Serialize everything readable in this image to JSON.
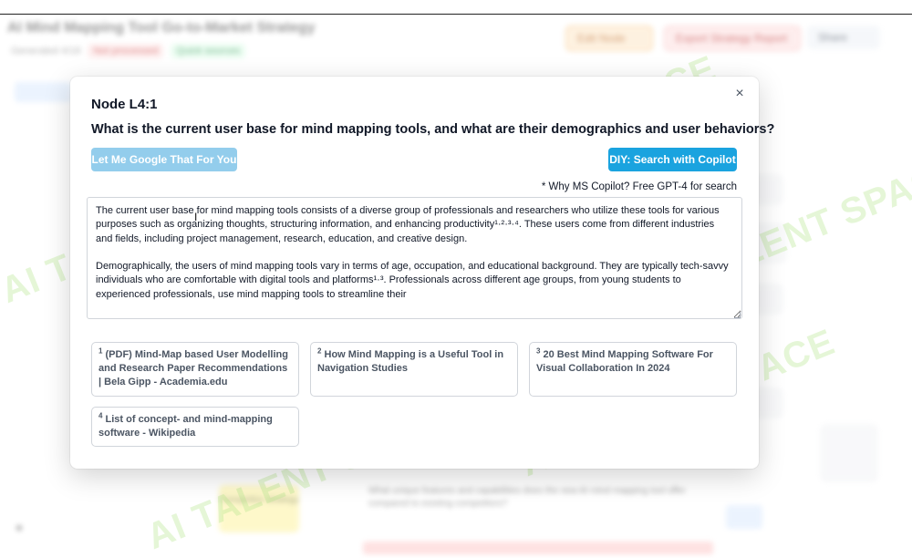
{
  "background": {
    "title": "AI Mind Mapping Tool Go-to-Market Strategy",
    "meta_text": "Generated 4/18",
    "meta_red": "Not processed",
    "meta_green": "Quick sources",
    "btn_orange": "Edit Node",
    "btn_pink": "Export Strategy Report",
    "btn_gray": "Share",
    "node_text": "Competitor strategy",
    "question_text": "What unique features and capabilities does the new AI mind mapping tool offer compared to existing competitors?"
  },
  "watermark": "AI TALENT SPACE",
  "modal": {
    "close_symbol": "×",
    "node_title": "Node L4:1",
    "question": "What is the current user base for mind mapping tools, and what are their demographics and user behaviors?",
    "google_button": "Let Me Google That For You",
    "copilot_button": "DIY: Search with Copilot",
    "copilot_note": "* Why MS Copilot? Free GPT-4 for search",
    "answer": "The current user base for mind mapping tools consists of a diverse group of professionals and researchers who utilize these tools for various purposes such as organizing thoughts, structuring information, and enhancing productivity¹·²·³·⁴. These users come from different industries and fields, including project management, research, education, and creative design.\n\nDemographically, the users of mind mapping tools vary in terms of age, occupation, and educational background. They are typically tech-savvy individuals who are comfortable with digital tools and platforms¹·³. Professionals across different age groups, from young students to experienced professionals, use mind mapping tools to streamline their",
    "sources": [
      {
        "num": "1",
        "title": "(PDF) Mind-Map based User Modelling and Research Paper Recommendations | Bela Gipp - Academia.edu"
      },
      {
        "num": "2",
        "title": "How Mind Mapping is a Useful Tool in Navigation Studies"
      },
      {
        "num": "3",
        "title": "20 Best Mind Mapping Software For Visual Collaboration In 2024"
      },
      {
        "num": "4",
        "title": "List of concept- and mind-mapping software - Wikipedia"
      }
    ]
  },
  "colors": {
    "copilot_blue": "#1aa3df",
    "google_light_blue": "#93cdec"
  }
}
